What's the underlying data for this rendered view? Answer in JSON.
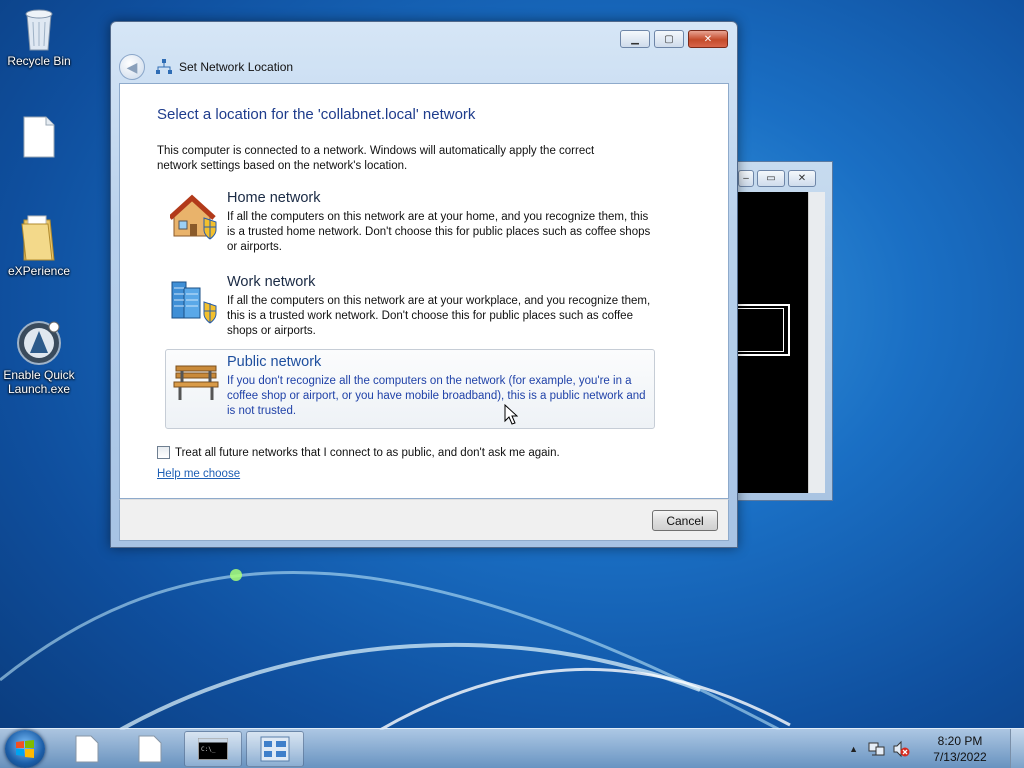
{
  "desktop": {
    "icons": [
      {
        "label": "Recycle Bin",
        "icon": "recycle-bin-icon"
      },
      {
        "label": "",
        "icon": "blank-file-icon"
      },
      {
        "label": "eXPerience",
        "icon": "folder-icon"
      },
      {
        "label": "Enable Quick Launch.exe",
        "icon": "quick-launch-app-icon"
      }
    ]
  },
  "dialog": {
    "header_title": "Set Network Location",
    "heading": "Select a location for the 'collabnet.local' network",
    "intro": "This computer is connected to a network. Windows will automatically apply the correct network settings based on the network's location.",
    "options": [
      {
        "title": "Home network",
        "description": "If all the computers on this network are at your home, and you recognize them, this is a trusted home network.  Don't choose this for public places such as coffee shops or airports.",
        "icon": "house-shield-icon"
      },
      {
        "title": "Work network",
        "description": "If all the computers on this network are at your workplace, and you recognize them, this is a trusted work network.  Don't choose this for public places such as coffee shops or airports.",
        "icon": "office-building-shield-icon"
      },
      {
        "title": "Public network",
        "description": "If you don't recognize all the computers on the network (for example, you're in a coffee shop or airport, or you have mobile broadband), this is a public network and is not trusted.",
        "icon": "park-bench-icon",
        "selected": true
      }
    ],
    "checkbox_label": "Treat all future networks that I connect to as public, and don't ask me again.",
    "checkbox_checked": false,
    "help_link": "Help me choose",
    "cancel_label": "Cancel"
  },
  "taskbar": {
    "items": [
      {
        "icon": "document-icon",
        "active": false
      },
      {
        "icon": "document-icon",
        "active": false
      },
      {
        "icon": "command-prompt-icon",
        "active": true
      },
      {
        "icon": "network-center-icon",
        "active": true
      }
    ],
    "clock": {
      "time": "8:20 PM",
      "date": "7/13/2022"
    }
  }
}
